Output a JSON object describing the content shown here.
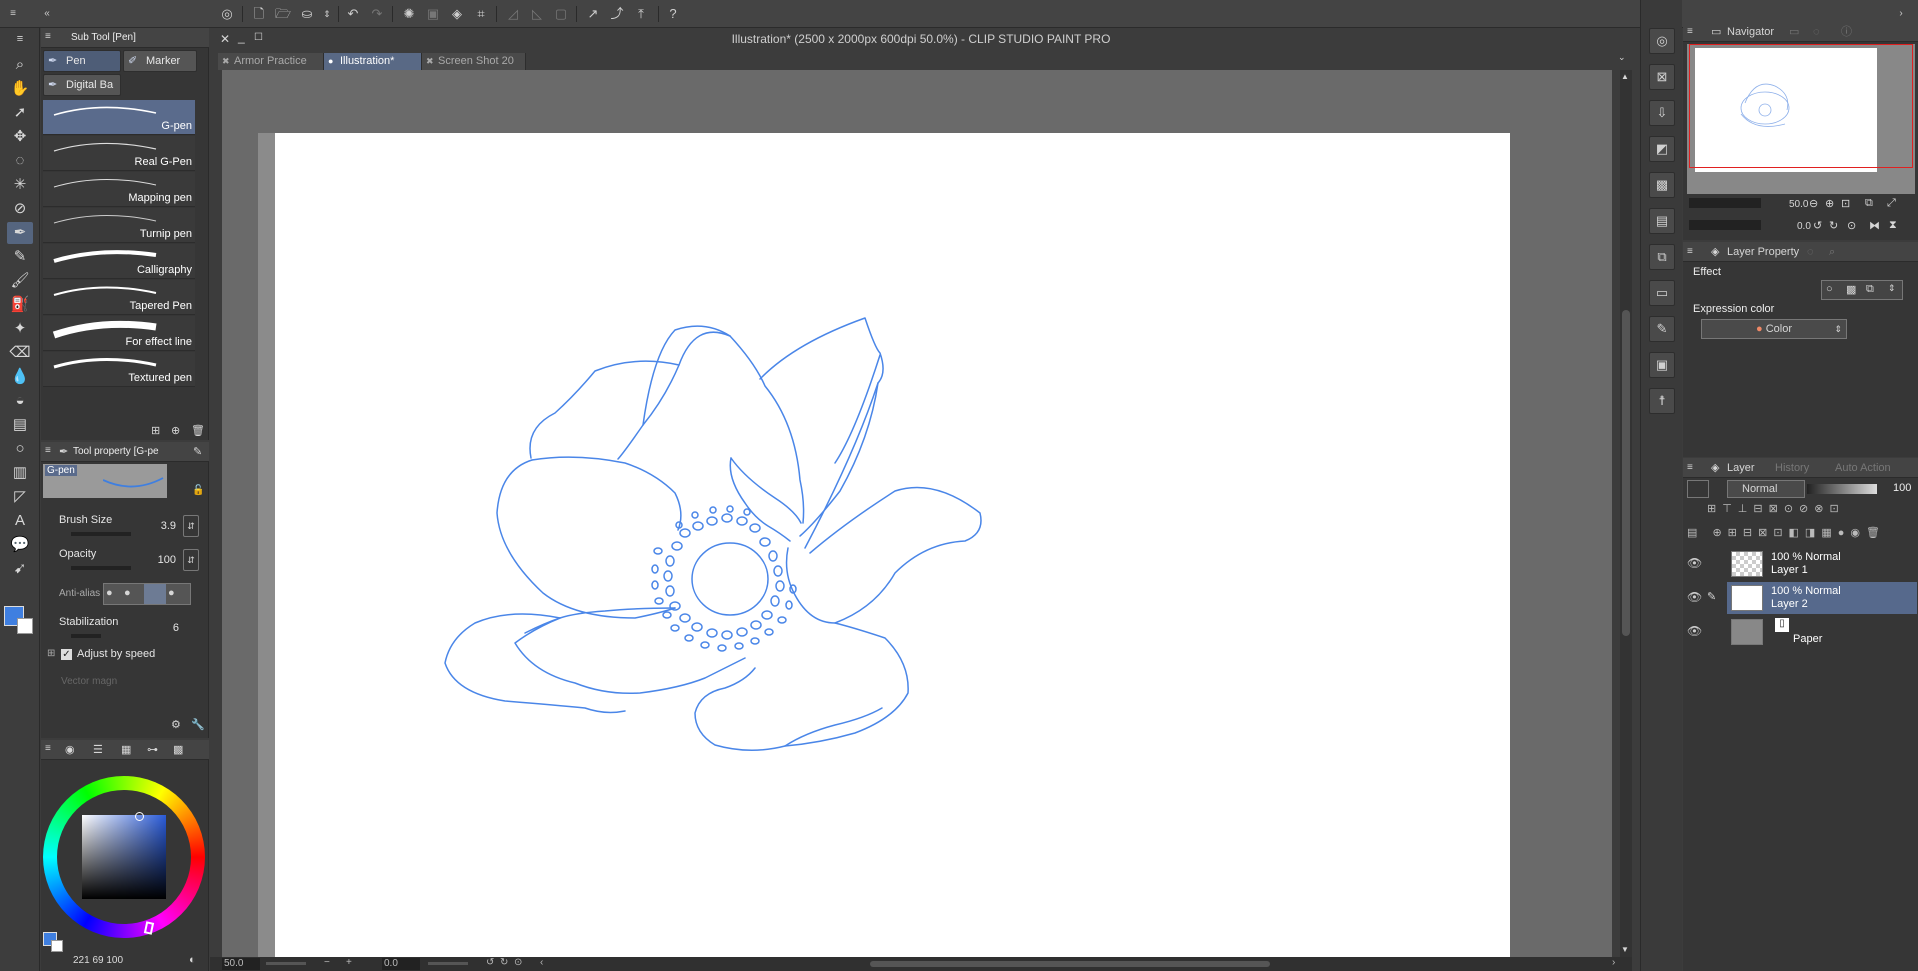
{
  "window": {
    "title": "Illustration* (2500 x 2000px 600dpi 50.0%)  - CLIP STUDIO PAINT PRO"
  },
  "doc_tabs": [
    {
      "label": "Armor Practice"
    },
    {
      "label": "Illustration*"
    },
    {
      "label": "Screen Shot 20"
    }
  ],
  "subtool": {
    "title": "Sub Tool [Pen]",
    "tabs": [
      "Pen",
      "Marker",
      "Digital Ba"
    ],
    "brushes": [
      "G-pen",
      "Real G-Pen",
      "Mapping pen",
      "Turnip pen",
      "Calligraphy",
      "Tapered Pen",
      "For effect line",
      "Textured pen"
    ]
  },
  "toolprop": {
    "title": "Tool property [G-pe",
    "preview_label": "G-pen",
    "brush_size_label": "Brush Size",
    "brush_size": "3.9",
    "opacity_label": "Opacity",
    "opacity": "100",
    "antialias_label": "Anti-alias",
    "stabilization_label": "Stabilization",
    "stabilization": "6",
    "adjust_label": "Adjust by speed",
    "vector_label": "Vector magn"
  },
  "color": {
    "readout": "221  69  100",
    "main_color": "#3f7fe0"
  },
  "status": {
    "zoom": "50.0",
    "angle": "0.0"
  },
  "navigator": {
    "title": "Navigator",
    "zoom": "50.0",
    "rotation": "0.0"
  },
  "layer_property": {
    "title": "Layer Property",
    "effect_label": "Effect",
    "expression_label": "Expression color",
    "expression_value": "Color"
  },
  "layers_panel": {
    "tabs": [
      "Layer",
      "History",
      "Auto Action"
    ],
    "blend_mode": "Normal",
    "opacity": "100",
    "layers": [
      {
        "line1": "100 % Normal",
        "line2": "Layer 1"
      },
      {
        "line1": "100 % Normal",
        "line2": "Layer 2"
      },
      {
        "line1": "",
        "line2": "Paper"
      }
    ]
  },
  "colors": {
    "accent": "#56698c",
    "stroke": "#4a86e8"
  }
}
